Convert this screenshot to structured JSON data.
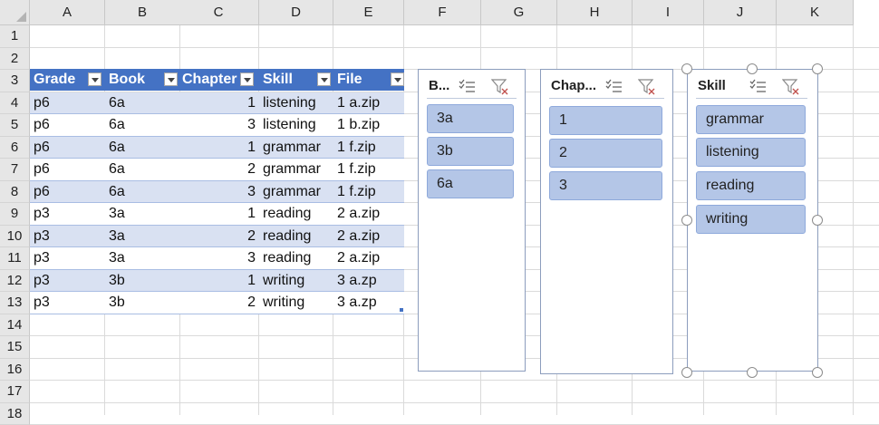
{
  "columns": [
    "A",
    "B",
    "C",
    "D",
    "E",
    "F",
    "G",
    "H",
    "I",
    "J",
    "K"
  ],
  "rows": [
    "1",
    "2",
    "3",
    "4",
    "5",
    "6",
    "7",
    "8",
    "9",
    "10",
    "11",
    "12",
    "13",
    "14",
    "15",
    "16",
    "17",
    "18"
  ],
  "table": {
    "headers": [
      "Grade",
      "Book",
      "Chapter",
      "Skill",
      "File"
    ],
    "rows": [
      [
        "p6",
        "6a",
        "1",
        "listening",
        "1 a.zip"
      ],
      [
        "p6",
        "6a",
        "3",
        "listening",
        "1 b.zip"
      ],
      [
        "p6",
        "6a",
        "1",
        "grammar",
        "1 f.zip"
      ],
      [
        "p6",
        "6a",
        "2",
        "grammar",
        "1 f.zip"
      ],
      [
        "p6",
        "6a",
        "3",
        "grammar",
        "1 f.zip"
      ],
      [
        "p3",
        "3a",
        "1",
        "reading",
        "2 a.zip"
      ],
      [
        "p3",
        "3a",
        "2",
        "reading",
        "2 a.zip"
      ],
      [
        "p3",
        "3a",
        "3",
        "reading",
        "2 a.zip"
      ],
      [
        "p3",
        "3b",
        "1",
        "writing",
        "3 a.zp"
      ],
      [
        "p3",
        "3b",
        "2",
        "writing",
        "3 a.zp"
      ]
    ]
  },
  "slicers": [
    {
      "title": "B...",
      "items": [
        "3a",
        "3b",
        "6a"
      ]
    },
    {
      "title": "Chap...",
      "items": [
        "1",
        "2",
        "3"
      ]
    },
    {
      "title": "Skill",
      "items": [
        "grammar",
        "listening",
        "reading",
        "writing"
      ]
    }
  ],
  "icons": {
    "multi_select": "multi-select-icon",
    "clear_filter": "clear-filter-icon"
  },
  "colors": {
    "header_fill": "#4472c4",
    "band_fill": "#d9e1f2",
    "slicer_item_fill": "#b4c6e7",
    "slicer_item_border": "#8ea9db"
  }
}
